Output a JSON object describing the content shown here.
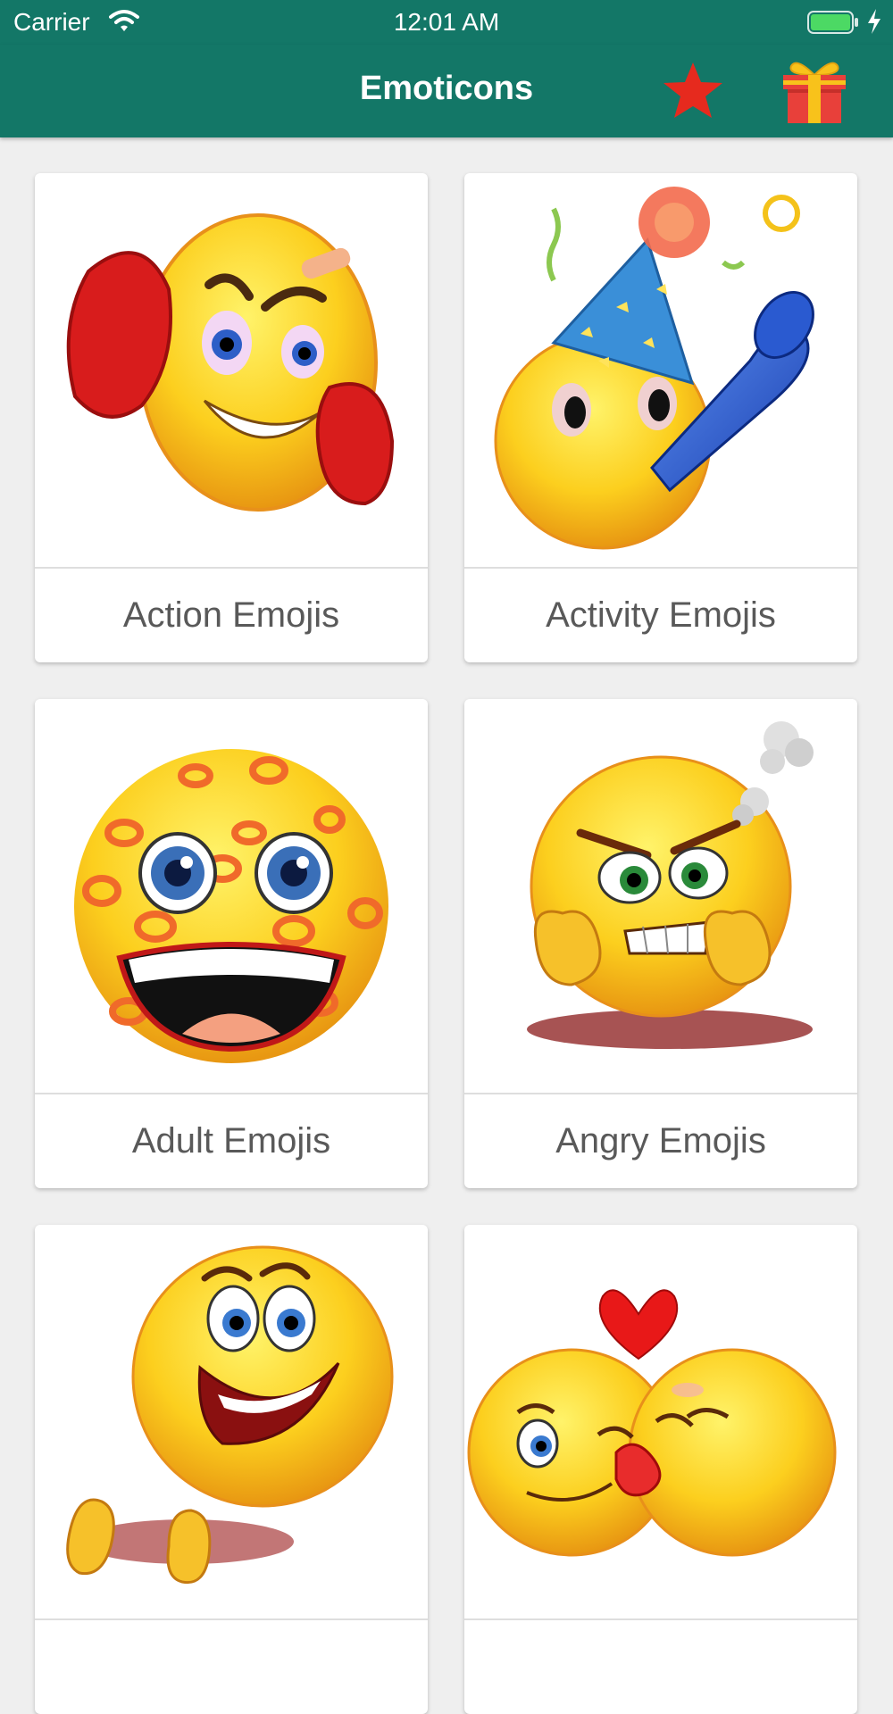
{
  "status_bar": {
    "carrier": "Carrier",
    "time": "12:01 AM",
    "battery_color": "#4cd964"
  },
  "nav": {
    "title": "Emoticons",
    "background": "#137767",
    "favorites_icon": "star-icon",
    "gift_icon": "gift-icon"
  },
  "categories": [
    {
      "label": "Action Emojis",
      "icon": "boxing-emoji-icon"
    },
    {
      "label": "Activity Emojis",
      "icon": "party-emoji-icon"
    },
    {
      "label": "Adult Emojis",
      "icon": "kissed-emoji-icon"
    },
    {
      "label": "Angry Emojis",
      "icon": "angry-emoji-icon"
    },
    {
      "label": "",
      "icon": "applause-emoji-icon"
    },
    {
      "label": "",
      "icon": "love-kiss-emoji-icon"
    }
  ]
}
